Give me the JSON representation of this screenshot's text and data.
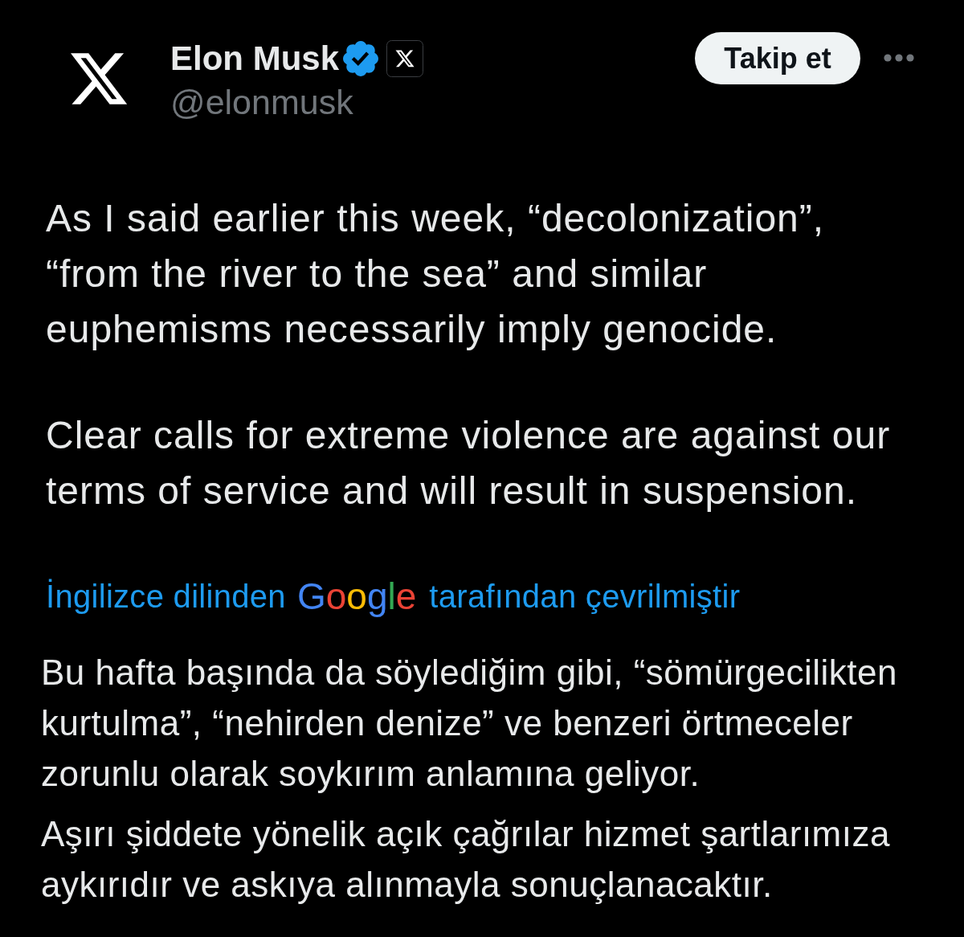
{
  "author": {
    "name": "Elon Musk",
    "handle": "@elonmusk",
    "verified": true,
    "affiliated": true
  },
  "follow_button": {
    "label": "Takip et"
  },
  "post": {
    "paragraphs": [
      "As I said earlier this week, “decolonization”, “from the river to the sea” and similar euphemisms necessarily imply genocide.",
      "Clear calls for extreme violence are against our terms of service and will result in suspension."
    ]
  },
  "translation": {
    "prefix": "İngilizce dilinden",
    "provider": "Google",
    "suffix": "tarafından çevrilmiştir",
    "paragraphs": [
      "Bu hafta başında da söylediğim gibi, “sömürgecilikten kurtulma”, “nehirden denize” ve benzeri örtmeceler zorunlu olarak soykırım anlamına geliyor.",
      "Aşırı şiddete yönelik açık çağrılar hizmet şartlarımıza aykırıdır ve askıya alınmayla sonuçlanacaktır."
    ]
  }
}
